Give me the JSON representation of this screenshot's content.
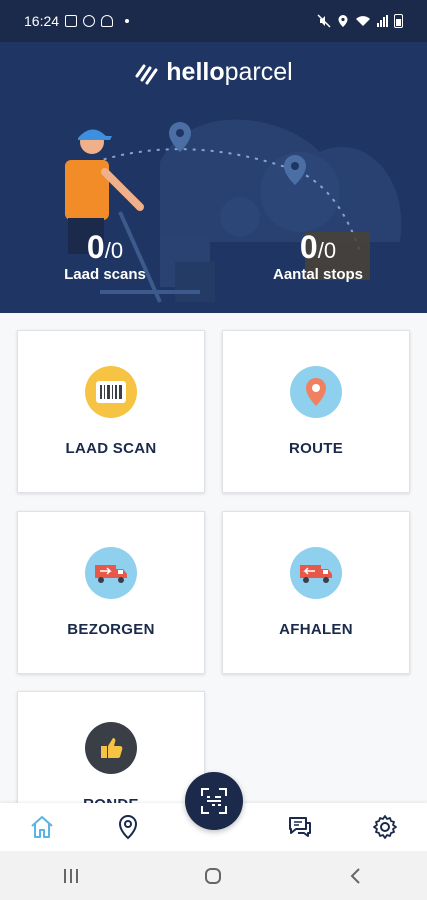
{
  "status_bar": {
    "time": "16:24"
  },
  "app": {
    "logo_bold": "hello",
    "logo_thin": "parcel"
  },
  "stats": {
    "load_scans": {
      "value": "0",
      "total": "/0",
      "label": "Laad scans"
    },
    "stops": {
      "value": "0",
      "total": "/0",
      "label": "Aantal stops"
    }
  },
  "tiles": [
    {
      "label": "LAAD SCAN",
      "icon": "barcode-icon"
    },
    {
      "label": "ROUTE",
      "icon": "map-pin-icon"
    },
    {
      "label": "BEZORGEN",
      "icon": "delivery-truck-icon"
    },
    {
      "label": "AFHALEN",
      "icon": "pickup-truck-icon"
    },
    {
      "label": "RONDE",
      "icon": "thumbs-up-icon"
    }
  ],
  "tabbar": [
    "home-icon",
    "location-icon",
    "scan-icon",
    "chat-icon",
    "settings-icon"
  ],
  "colors": {
    "navy": "#1b2a4a",
    "hero": "#1f3563",
    "accent_orange": "#f28c28",
    "light_blue": "#8fd0ee",
    "yellow": "#f6c343"
  }
}
